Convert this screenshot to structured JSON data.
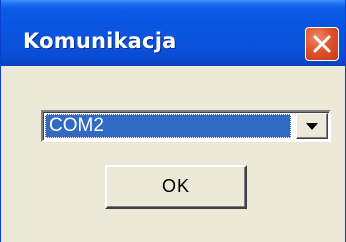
{
  "window": {
    "title": "Komunikacja",
    "close_icon": "close-x-icon"
  },
  "port_select": {
    "selected_value": "COM2",
    "arrow_icon": "chevron-down-icon"
  },
  "ok_button": {
    "label": "OK"
  },
  "colors": {
    "titlebar": "#0a55e0",
    "selection": "#316ac5",
    "dialog_bg": "#ece9d8",
    "close_button": "#e0532e"
  }
}
